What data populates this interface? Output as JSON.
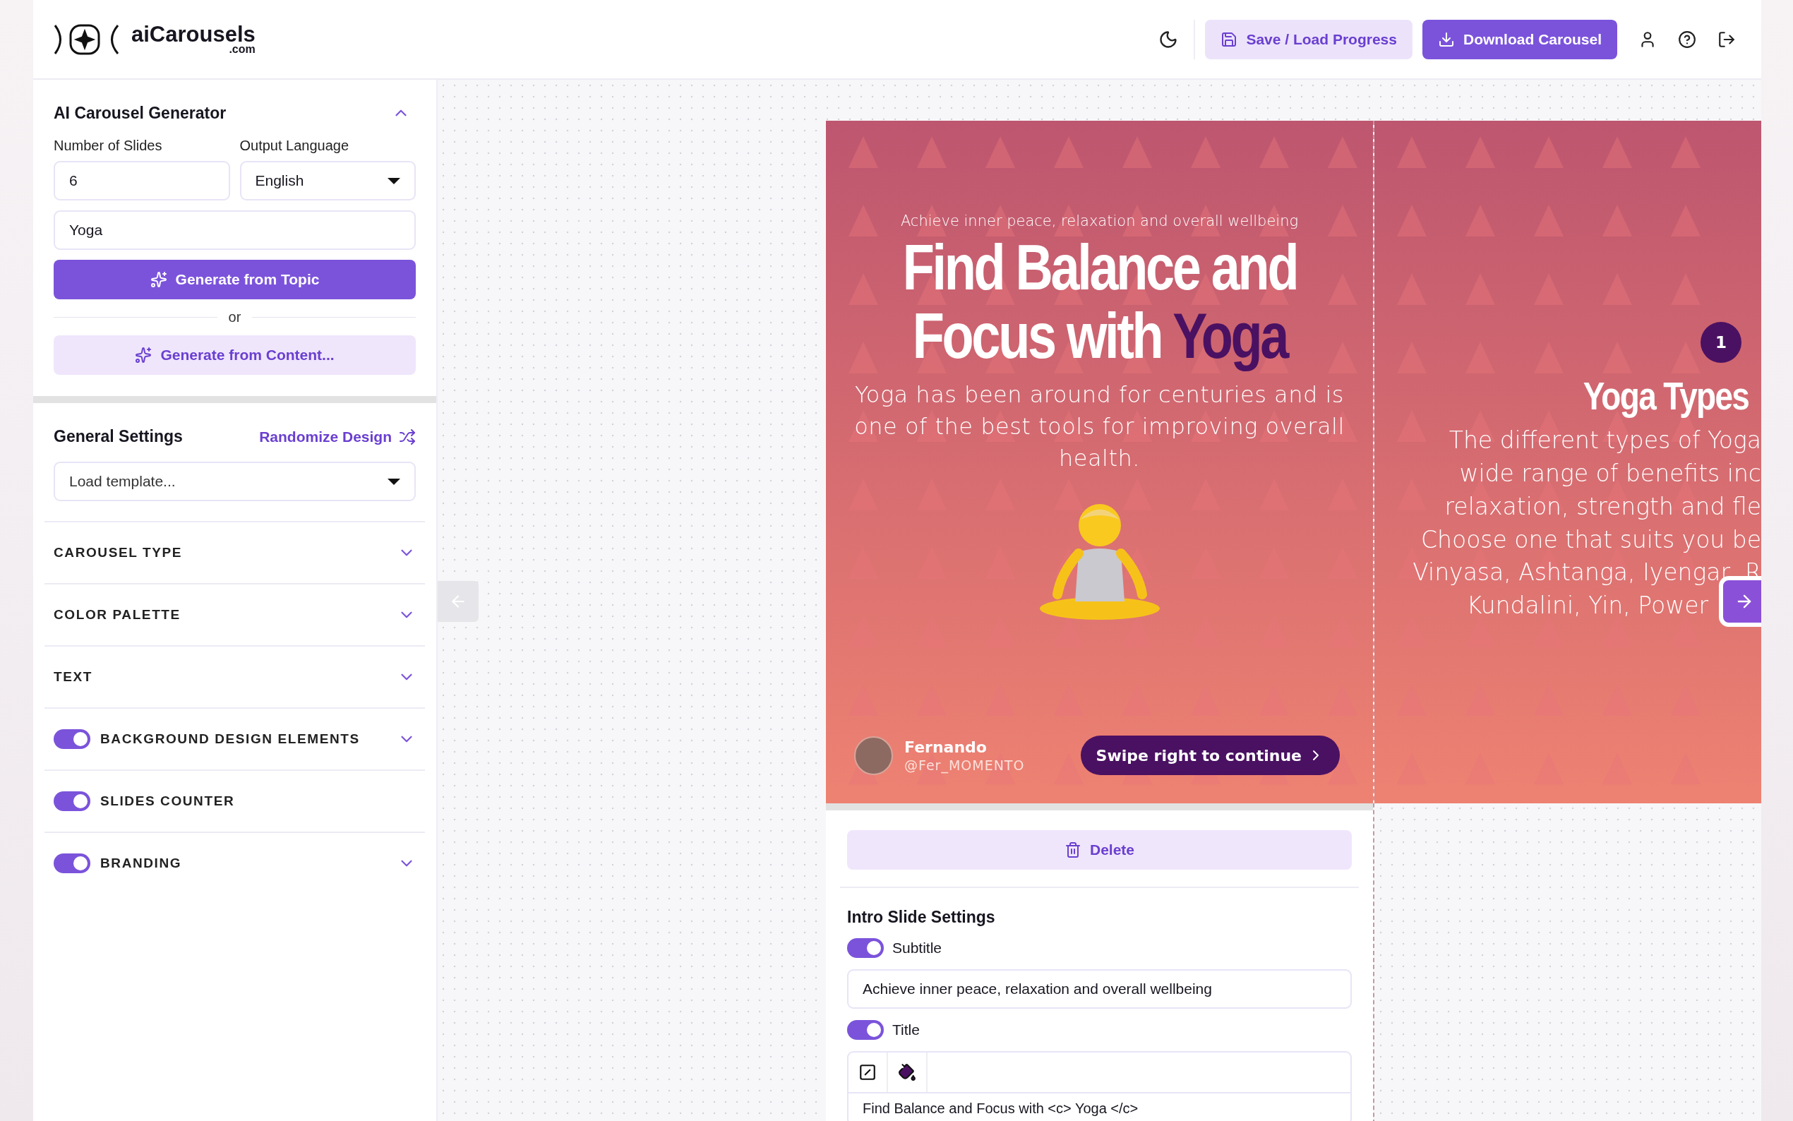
{
  "header": {
    "logo": {
      "name": "aiCarousels",
      "suffix": ".com"
    },
    "buttons": [
      {
        "label": "Save / Load Progress",
        "kind": "secondary"
      },
      {
        "label": "Download Carousel",
        "kind": "primary"
      }
    ]
  },
  "generator": {
    "title": "AI Carousel Generator",
    "expanded": true,
    "slides_label": "Number of Slides",
    "slides_value": "6",
    "language_label": "Output Language",
    "language_value": "English",
    "topic_value": "Yoga",
    "generate_topic": "Generate from Topic",
    "or": "or",
    "generate_content": "Generate from Content..."
  },
  "general": {
    "title": "General Settings",
    "randomize": "Randomize Design",
    "template_placeholder": "Load template...",
    "sections": [
      {
        "label": "CAROUSEL TYPE",
        "kind": "plain",
        "expandable": true
      },
      {
        "label": "COLOR PALETTE",
        "kind": "plain",
        "expandable": true
      },
      {
        "label": "TEXT",
        "kind": "plain",
        "expandable": true
      },
      {
        "label": "BACKGROUND DESIGN ELEMENTS",
        "kind": "toggle",
        "on": true,
        "expandable": true
      },
      {
        "label": "SLIDES COUNTER",
        "kind": "toggle",
        "on": true,
        "expandable": false
      },
      {
        "label": "BRANDING",
        "kind": "toggle",
        "on": true,
        "expandable": true
      }
    ]
  },
  "intro_slide": {
    "subtitle": "Achieve inner peace, relaxation and overall wellbeing",
    "title": "Find Balance and Focus with",
    "title_highlight": "Yoga",
    "body": "Yoga has been around for centuries and is one of the best tools for improving overall health.",
    "author_name": "Fernando",
    "author_handle": "@Fer_MOMENTO",
    "swipe": "Swipe right to continue"
  },
  "second_slide": {
    "counter": "1",
    "title": "Yoga Types",
    "lines": [
      "The different types of Yoga",
      "wide range of benefits inc",
      "relaxation, strength and fle",
      "Choose one that suits you be",
      "Vinyasa, Ashtanga, Iyengar, R",
      "Kundalini, Yin, Power"
    ]
  },
  "slide_settings": {
    "delete": "Delete",
    "title": "Intro Slide Settings",
    "fields": [
      {
        "label": "Subtitle",
        "on": true,
        "kind": "input",
        "value": "Achieve inner peace, relaxation and overall wellbeing"
      },
      {
        "label": "Title",
        "on": true,
        "kind": "editor",
        "value": "Find Balance and Focus with <c> Yoga </c>"
      }
    ]
  }
}
